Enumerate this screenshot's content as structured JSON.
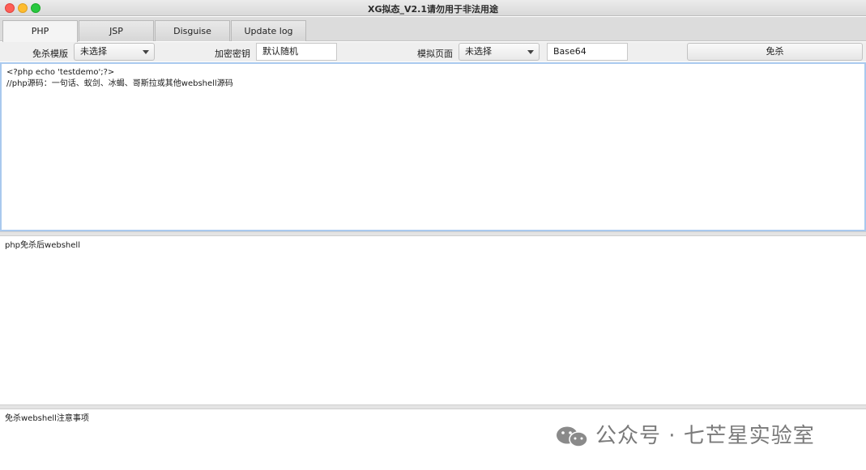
{
  "window": {
    "title": "XG拟态_V2.1请勿用于非法用途"
  },
  "tabs": [
    {
      "label": "PHP",
      "active": true
    },
    {
      "label": "JSP",
      "active": false
    },
    {
      "label": "Disguise",
      "active": false
    },
    {
      "label": "Update log",
      "active": false
    }
  ],
  "options": {
    "template_label": "免杀模版",
    "template_value": "未选择",
    "key_label": "加密密钥",
    "key_value": "默认随机",
    "page_label": "模拟页面",
    "page_value": "未选择",
    "encoding_value": "Base64",
    "run_button": "免杀"
  },
  "source_pane": {
    "text": "<?php echo 'testdemo';?>\n//php源码：一句话、蚁剑、冰蝎、哥斯拉或其他webshell源码"
  },
  "output_pane": {
    "text": "php免杀后webshell"
  },
  "notes_pane": {
    "text": "免杀webshell注意事项"
  },
  "watermark": {
    "text": "公众号 · 七芒星实验室",
    "icon": "wechat-icon"
  }
}
